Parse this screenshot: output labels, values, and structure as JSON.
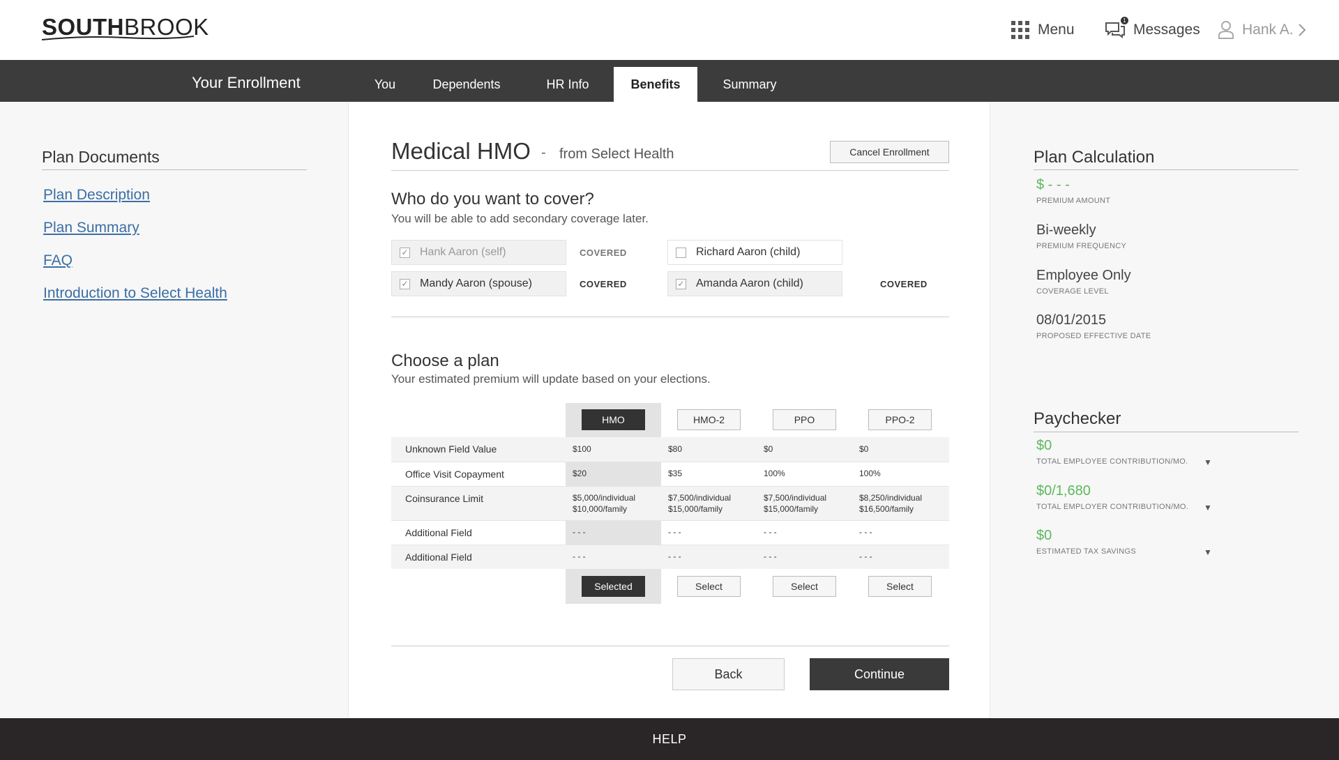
{
  "header": {
    "logo_bold": "SOUTH",
    "logo_light": "BROOK",
    "menu_label": "Menu",
    "messages_label": "Messages",
    "messages_badge": "1",
    "user_label": "Hank A."
  },
  "nav": {
    "title": "Your Enrollment",
    "tabs": [
      "You",
      "Dependents",
      "HR Info",
      "Benefits",
      "Summary"
    ],
    "active_tab": "Benefits"
  },
  "documents": {
    "title": "Plan Documents",
    "links": [
      "Plan Description",
      "Plan Summary",
      "FAQ",
      "Introduction to Select Health"
    ]
  },
  "plan_header": {
    "title": "Medical HMO",
    "separator": "-",
    "from": "from Select Health",
    "cancel_label": "Cancel Enrollment"
  },
  "coverage": {
    "title": "Who do you want to cover?",
    "subtitle": "You will be able to add secondary coverage later.",
    "members": [
      {
        "name": "Hank Aaron (self)",
        "checked": true,
        "disabled": true,
        "status": "COVERED"
      },
      {
        "name": "Richard Aaron (child)",
        "checked": false,
        "disabled": false,
        "status": ""
      },
      {
        "name": "Mandy Aaron (spouse)",
        "checked": true,
        "disabled": false,
        "status": "COVERED"
      },
      {
        "name": "Amanda Aaron (child)",
        "checked": true,
        "disabled": false,
        "status": "COVERED"
      }
    ]
  },
  "plans": {
    "title": "Choose a plan",
    "subtitle": "Your estimated premium will update based on your elections.",
    "columns": [
      "HMO",
      "HMO-2",
      "PPO",
      "PPO-2"
    ],
    "selected": "HMO",
    "rows": [
      {
        "label": "Unknown Field Value",
        "values": [
          "$100",
          "$80",
          "$0",
          "$0"
        ]
      },
      {
        "label": "Office Visit Copayment",
        "values": [
          "$20",
          "$35",
          "100%",
          "100%"
        ]
      },
      {
        "label": "Coinsurance Limit",
        "values": [
          [
            "$5,000/individual",
            "$10,000/family"
          ],
          [
            "$7,500/individual",
            "$15,000/family"
          ],
          [
            "$7,500/individual",
            "$15,000/family"
          ],
          [
            "$8,250/individual",
            "$16,500/family"
          ]
        ]
      },
      {
        "label": "Additional Field",
        "values": [
          "- - -",
          "- - -",
          "- - -",
          "- - -"
        ]
      },
      {
        "label": "Additional Field",
        "values": [
          "- - -",
          "- - -",
          "- - -",
          "- - -"
        ]
      }
    ],
    "selected_label": "Selected",
    "select_label": "Select"
  },
  "actions": {
    "back": "Back",
    "continue": "Continue"
  },
  "plan_calc": {
    "title": "Plan Calculation",
    "items": [
      {
        "value": "$ - - -",
        "label": "PREMIUM AMOUNT",
        "green": true
      },
      {
        "value": "Bi-weekly",
        "label": "PREMIUM FREQUENCY",
        "green": false
      },
      {
        "value": "Employee Only",
        "label": "COVERAGE LEVEL",
        "green": false
      },
      {
        "value": "08/01/2015",
        "label": "PROPOSED EFFECTIVE DATE",
        "green": false
      }
    ]
  },
  "paychecker": {
    "title": "Paychecker",
    "items": [
      {
        "value": "$0",
        "label": "TOTAL EMPLOYEE CONTRIBUTION/MO."
      },
      {
        "value": "$0/1,680",
        "label": "TOTAL EMPLOYER CONTRIBUTION/MO."
      },
      {
        "value": "$0",
        "label": "ESTIMATED TAX SAVINGS"
      }
    ]
  },
  "footer": {
    "label": "HELP"
  },
  "colors": {
    "accent_green": "#5cb85c",
    "nav_bg": "#3c3c3c",
    "footer_bg": "#2a2627",
    "link": "#3b6ea5"
  }
}
